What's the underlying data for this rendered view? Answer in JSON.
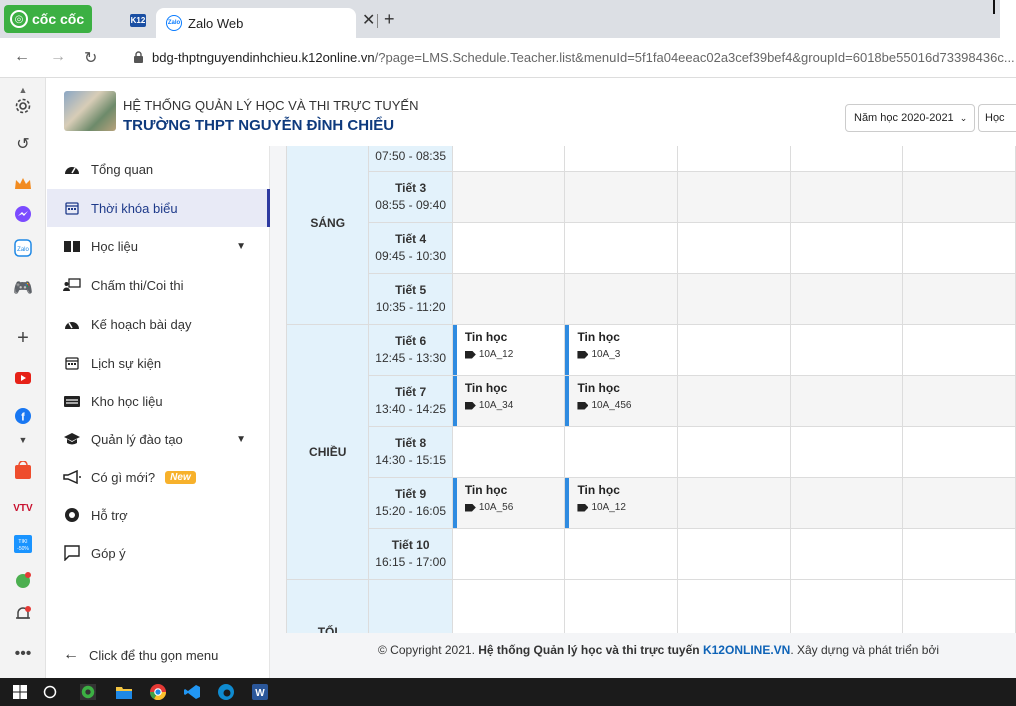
{
  "browser": {
    "name": "cốc cốc",
    "tab_title": "Zalo Web",
    "tab_k12": "K12",
    "zalo_icon_text": "Zalo",
    "url_host": "bdg-thptnguyendinhchieu.k12online.vn",
    "url_rest": "/?page=LMS.Schedule.Teacher.list&menuId=5f1fa04eeac02a3cef39bef4&groupId=6018be55016d73398436c..."
  },
  "header": {
    "system_title": "HỆ THỐNG QUẢN LÝ HỌC VÀ THI TRỰC TUYẾN",
    "school_name": "TRƯỜNG THPT NGUYỄN ĐÌNH CHIỂU",
    "year_select": "Năm học 2020-2021",
    "term_select": "Học"
  },
  "menu": {
    "items": [
      {
        "label": "Tổng quan",
        "icon": "dashboard-icon"
      },
      {
        "label": "Thời khóa biểu",
        "icon": "calendar-icon",
        "active": true
      },
      {
        "label": "Học liệu",
        "icon": "book-icon",
        "has_children": true
      },
      {
        "label": "Chấm thi/Coi thi",
        "icon": "exam-icon"
      },
      {
        "label": "Kế hoạch bài dạy",
        "icon": "plan-icon"
      },
      {
        "label": "Lịch sự kiện",
        "icon": "event-calendar-icon"
      },
      {
        "label": "Kho học liệu",
        "icon": "archive-icon"
      },
      {
        "label": "Quản lý đào tạo",
        "icon": "graduation-icon",
        "has_children": true
      },
      {
        "label": "Có gì mới?",
        "icon": "megaphone-icon",
        "badge": "New"
      },
      {
        "label": "Hỗ trợ",
        "icon": "support-icon"
      },
      {
        "label": "Góp ý",
        "icon": "feedback-icon"
      }
    ],
    "collapse_label": "Click để thu gọn menu"
  },
  "schedule": {
    "sessions": {
      "morning": "SÁNG",
      "afternoon": "CHIỀU",
      "evening": "TỐI"
    },
    "rows": [
      {
        "period": "",
        "time": "07:50 - 08:35",
        "lessons": [
          null,
          null,
          null,
          null,
          null
        ]
      },
      {
        "period": "Tiết 3",
        "time": "08:55 - 09:40",
        "lessons": [
          null,
          null,
          null,
          null,
          null
        ]
      },
      {
        "period": "Tiết 4",
        "time": "09:45 - 10:30",
        "lessons": [
          null,
          null,
          null,
          null,
          null
        ]
      },
      {
        "period": "Tiết 5",
        "time": "10:35 - 11:20",
        "lessons": [
          null,
          null,
          null,
          null,
          null
        ]
      },
      {
        "period": "Tiết 6",
        "time": "12:45 - 13:30",
        "lessons": [
          {
            "subject": "Tin học",
            "class": "10A_12"
          },
          {
            "subject": "Tin học",
            "class": "10A_3"
          },
          null,
          null,
          null
        ]
      },
      {
        "period": "Tiết 7",
        "time": "13:40 - 14:25",
        "lessons": [
          {
            "subject": "Tin học",
            "class": "10A_34"
          },
          {
            "subject": "Tin học",
            "class": "10A_456"
          },
          null,
          null,
          null
        ]
      },
      {
        "period": "Tiết 8",
        "time": "14:30 - 15:15",
        "lessons": [
          null,
          null,
          null,
          null,
          null
        ]
      },
      {
        "period": "Tiết 9",
        "time": "15:20 - 16:05",
        "lessons": [
          {
            "subject": "Tin học",
            "class": "10A_56"
          },
          {
            "subject": "Tin học",
            "class": "10A_12"
          },
          null,
          null,
          null
        ]
      },
      {
        "period": "Tiết 10",
        "time": "16:15 - 17:00",
        "lessons": [
          null,
          null,
          null,
          null,
          null
        ]
      }
    ]
  },
  "footer": {
    "prefix": "© Copyright 2021. ",
    "system": "Hệ thống Quản lý học và thi trực tuyến",
    "brand": "K12ONLINE.VN",
    "suffix": ". Xây dựng và phát triển bởi"
  },
  "colors": {
    "accent": "#2e3aa0",
    "session_bg": "#e3f2fb",
    "lesson_bar": "#2f8be0",
    "brand_green": "#3cb043"
  }
}
